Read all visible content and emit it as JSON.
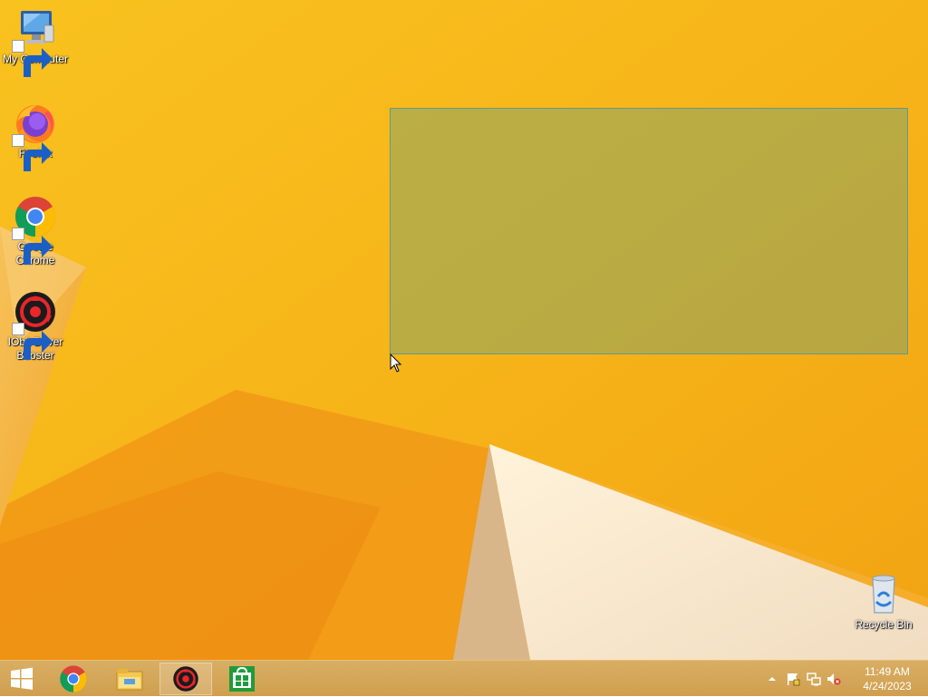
{
  "desktop": {
    "icons": [
      {
        "label": "My Computer",
        "icon": "computer-icon"
      },
      {
        "label": "Firefox",
        "icon": "firefox-icon"
      },
      {
        "label": "Google\nChrome",
        "icon": "chrome-icon"
      },
      {
        "label": "IObit Driver\nBooster",
        "icon": "driver-booster-icon"
      },
      {
        "label": "Recycle Bin",
        "icon": "recycle-bin-icon"
      }
    ]
  },
  "taskbar": {
    "start_icon": "windows-start-icon",
    "pinned": [
      {
        "name": "Google Chrome",
        "icon": "chrome-icon",
        "active": false
      },
      {
        "name": "File Explorer",
        "icon": "file-explorer-icon",
        "active": false
      },
      {
        "name": "IObit Driver Booster",
        "icon": "driver-booster-icon",
        "active": true
      },
      {
        "name": "Store",
        "icon": "store-icon",
        "active": false
      }
    ],
    "tray": {
      "icons": [
        "show-hidden-icons-chevron",
        "action-center-flag-icon",
        "network-icon",
        "volume-muted-icon"
      ],
      "time": "11:49 AM",
      "date": "4/24/2023"
    }
  },
  "colors": {
    "wallpaper": "#f7b519",
    "taskbar": "#d6a85a",
    "selection": "#70a078"
  }
}
